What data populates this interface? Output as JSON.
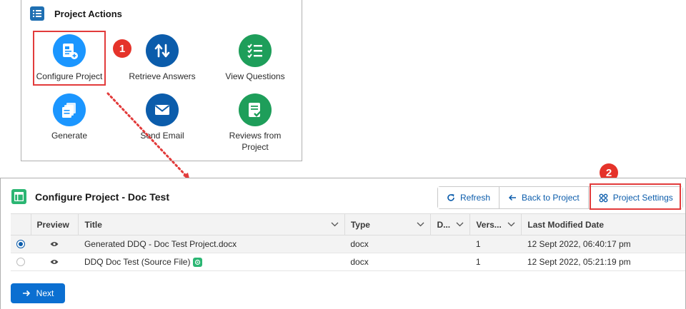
{
  "actions_panel": {
    "title": "Project Actions",
    "items": [
      {
        "label": "Configure Project",
        "icon": "configure-project-icon",
        "color": "#1b96ff"
      },
      {
        "label": "Retrieve Answers",
        "icon": "retrieve-answers-icon",
        "color": "#0b5cab"
      },
      {
        "label": "View Questions",
        "icon": "view-questions-icon",
        "color": "#1e9e5a"
      },
      {
        "label": "Generate",
        "icon": "generate-icon",
        "color": "#1b96ff"
      },
      {
        "label": "Send Email",
        "icon": "send-email-icon",
        "color": "#0b5cab"
      },
      {
        "label": "Reviews from Project",
        "icon": "reviews-icon",
        "color": "#1e9e5a"
      }
    ]
  },
  "callouts": {
    "step1": "1",
    "step2": "2",
    "highlight_color": "#e23b3b"
  },
  "config_card": {
    "title": "Configure Project - Doc Test",
    "buttons": {
      "refresh": "Refresh",
      "back": "Back to Project",
      "settings": "Project Settings"
    },
    "table": {
      "columns": [
        "Preview",
        "Title",
        "Type",
        "D...",
        "Vers...",
        "Last Modified Date"
      ],
      "rows": [
        {
          "selected": true,
          "title": "Generated DDQ - Doc Test Project.docx",
          "type": "docx",
          "d": "",
          "version": "1",
          "modified": "12 Sept 2022, 06:40:17 pm"
        },
        {
          "selected": false,
          "title": "DDQ Doc Test (Source File)",
          "type": "docx",
          "d": "",
          "version": "1",
          "modified": "12 Sept 2022, 05:21:19 pm"
        }
      ]
    },
    "next_label": "Next"
  }
}
